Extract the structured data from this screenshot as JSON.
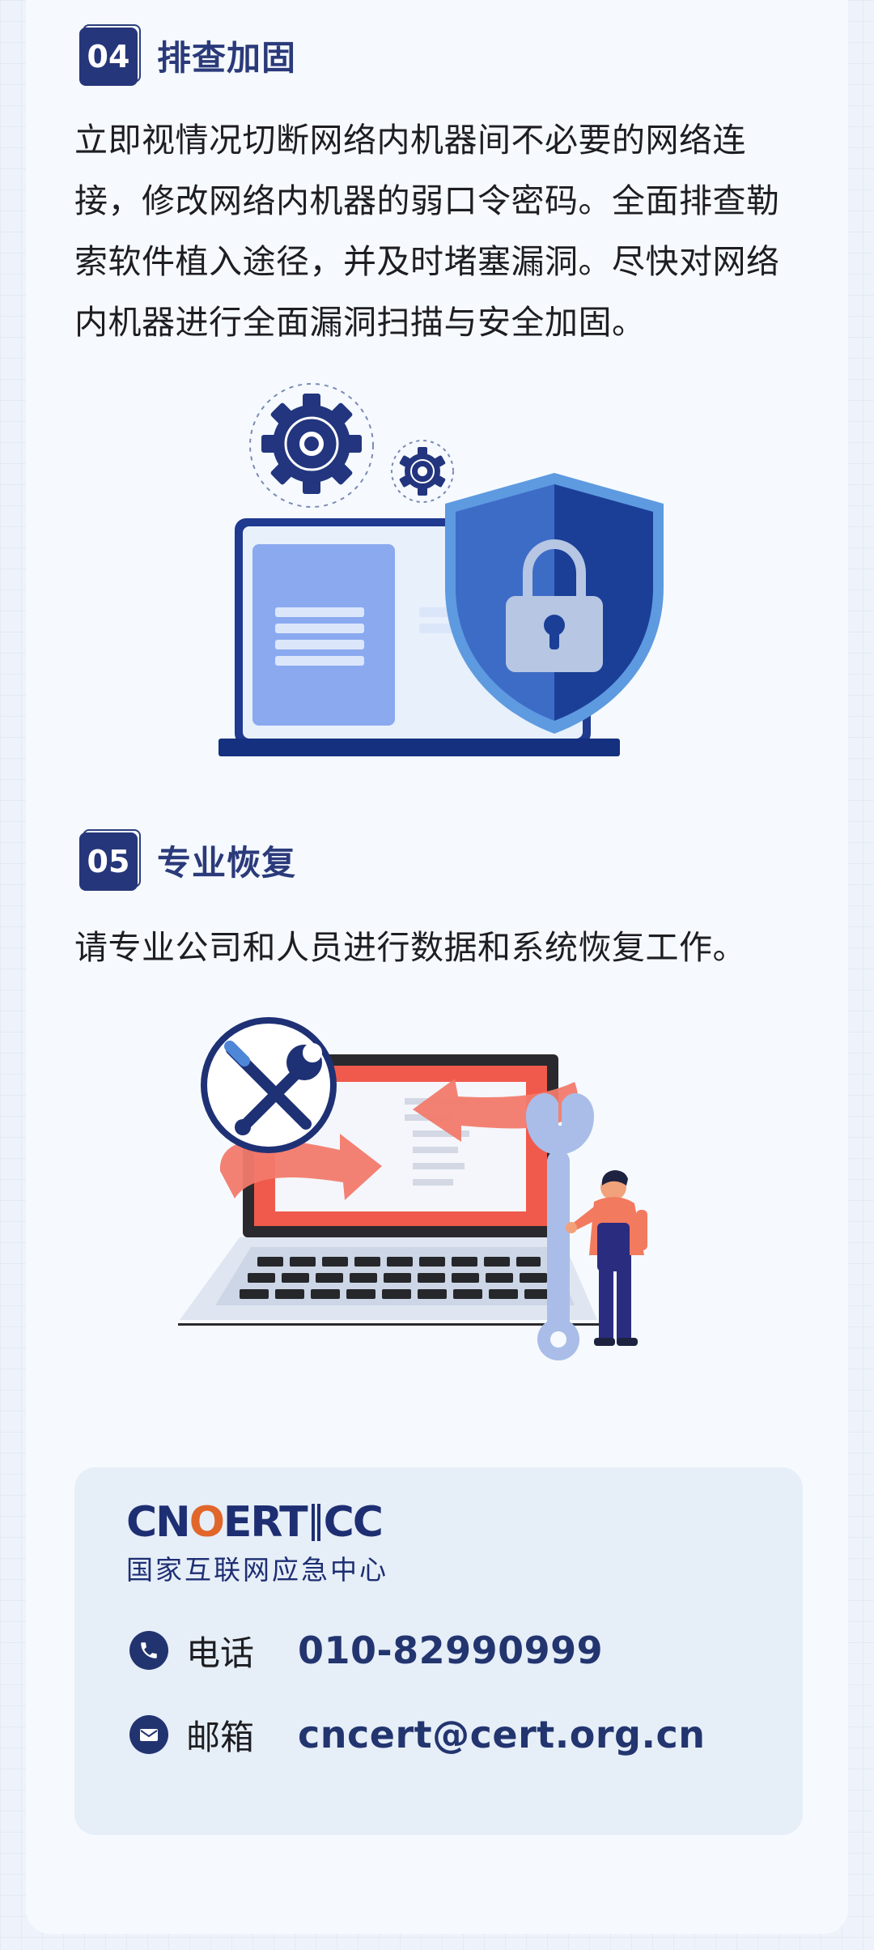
{
  "section4": {
    "number": "04",
    "title": "排查加固",
    "lines": [
      "立即视情况切断网络内机器间不必要的网络连",
      "接，修改网络内机器的弱口令密码。全面排查勒",
      "索软件植入途径，并及时堵塞漏洞。尽快对网络",
      "内机器进行全面漏洞扫描与安全加固。"
    ]
  },
  "section5": {
    "number": "05",
    "title": "专业恢复",
    "lines": [
      "请专业公司和人员进行数据和系统恢复工作。"
    ]
  },
  "contact": {
    "logo_prefix": "CN",
    "logo_o": "O",
    "logo_suffix": "ERT",
    "logo_cc": "CC",
    "logo_subtitle": "国家互联网应急中心",
    "phone_label": "电话",
    "phone_value": "010-82990999",
    "email_label": "邮箱",
    "email_value": "cncert@cert.org.cn"
  },
  "colors": {
    "navy": "#26367a",
    "accent_blue": "#4d7fd6",
    "salmon": "#f07060",
    "card_bg": "#f6fafe",
    "contact_bg": "#e6eef8"
  },
  "icons": [
    "gear-icon",
    "shield-lock-icon",
    "laptop-icon",
    "wrench-screwdriver-icon",
    "refresh-arrows-icon",
    "phone-icon",
    "mail-icon"
  ]
}
